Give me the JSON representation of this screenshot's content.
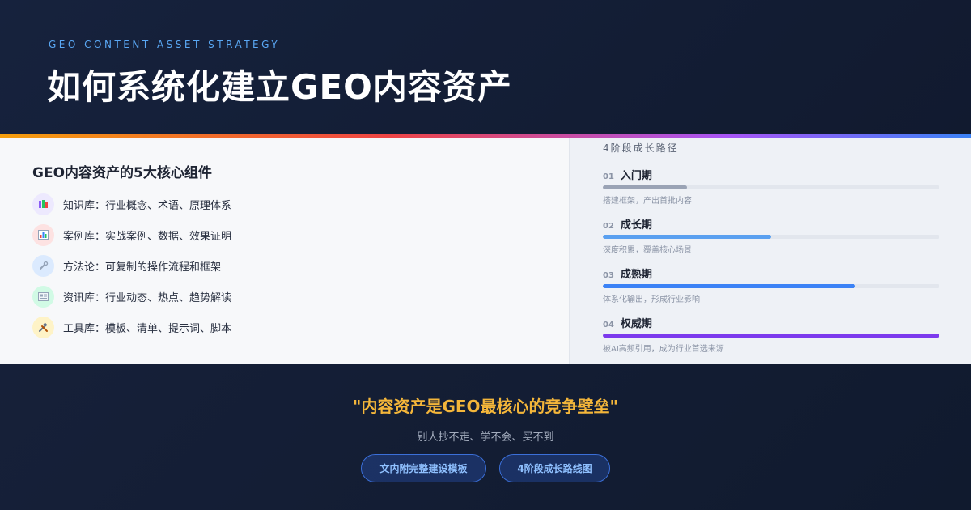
{
  "header": {
    "eyebrow": "GEO CONTENT ASSET STRATEGY",
    "title": "如何系统化建立GEO内容资产"
  },
  "components": {
    "title": "GEO内容资产的5大核心组件",
    "items": [
      {
        "icon": "books-icon",
        "label": "知识库：行业概念、术语、原理体系"
      },
      {
        "icon": "bar-chart-icon",
        "label": "案例库：实战案例、数据、效果证明"
      },
      {
        "icon": "wrench-icon",
        "label": "方法论：可复制的操作流程和框架"
      },
      {
        "icon": "newspaper-icon",
        "label": "资讯库：行业动态、热点、趋势解读"
      },
      {
        "icon": "tools-icon",
        "label": "工具库：模板、清单、提示词、脚本"
      }
    ]
  },
  "stages": {
    "title": "4阶段成长路径",
    "items": [
      {
        "num": "01",
        "name": "入门期",
        "desc": "搭建框架，产出首批内容",
        "progress": 0.25,
        "color": "#9aa3b5"
      },
      {
        "num": "02",
        "name": "成长期",
        "desc": "深度积累，覆盖核心场景",
        "progress": 0.5,
        "color": "#5aa0f0"
      },
      {
        "num": "03",
        "name": "成熟期",
        "desc": "体系化输出，形成行业影响",
        "progress": 0.75,
        "color": "#3b82f6"
      },
      {
        "num": "04",
        "name": "权威期",
        "desc": "被AI高频引用，成为行业首选来源",
        "progress": 1.0,
        "color": "#7c3aed"
      }
    ]
  },
  "footer": {
    "quote": "\"内容资产是GEO最核心的竞争壁垒\"",
    "subtitle": "别人抄不走、学不会、买不到",
    "buttons": [
      "文内附完整建设模板",
      "4阶段成长路线图"
    ]
  }
}
